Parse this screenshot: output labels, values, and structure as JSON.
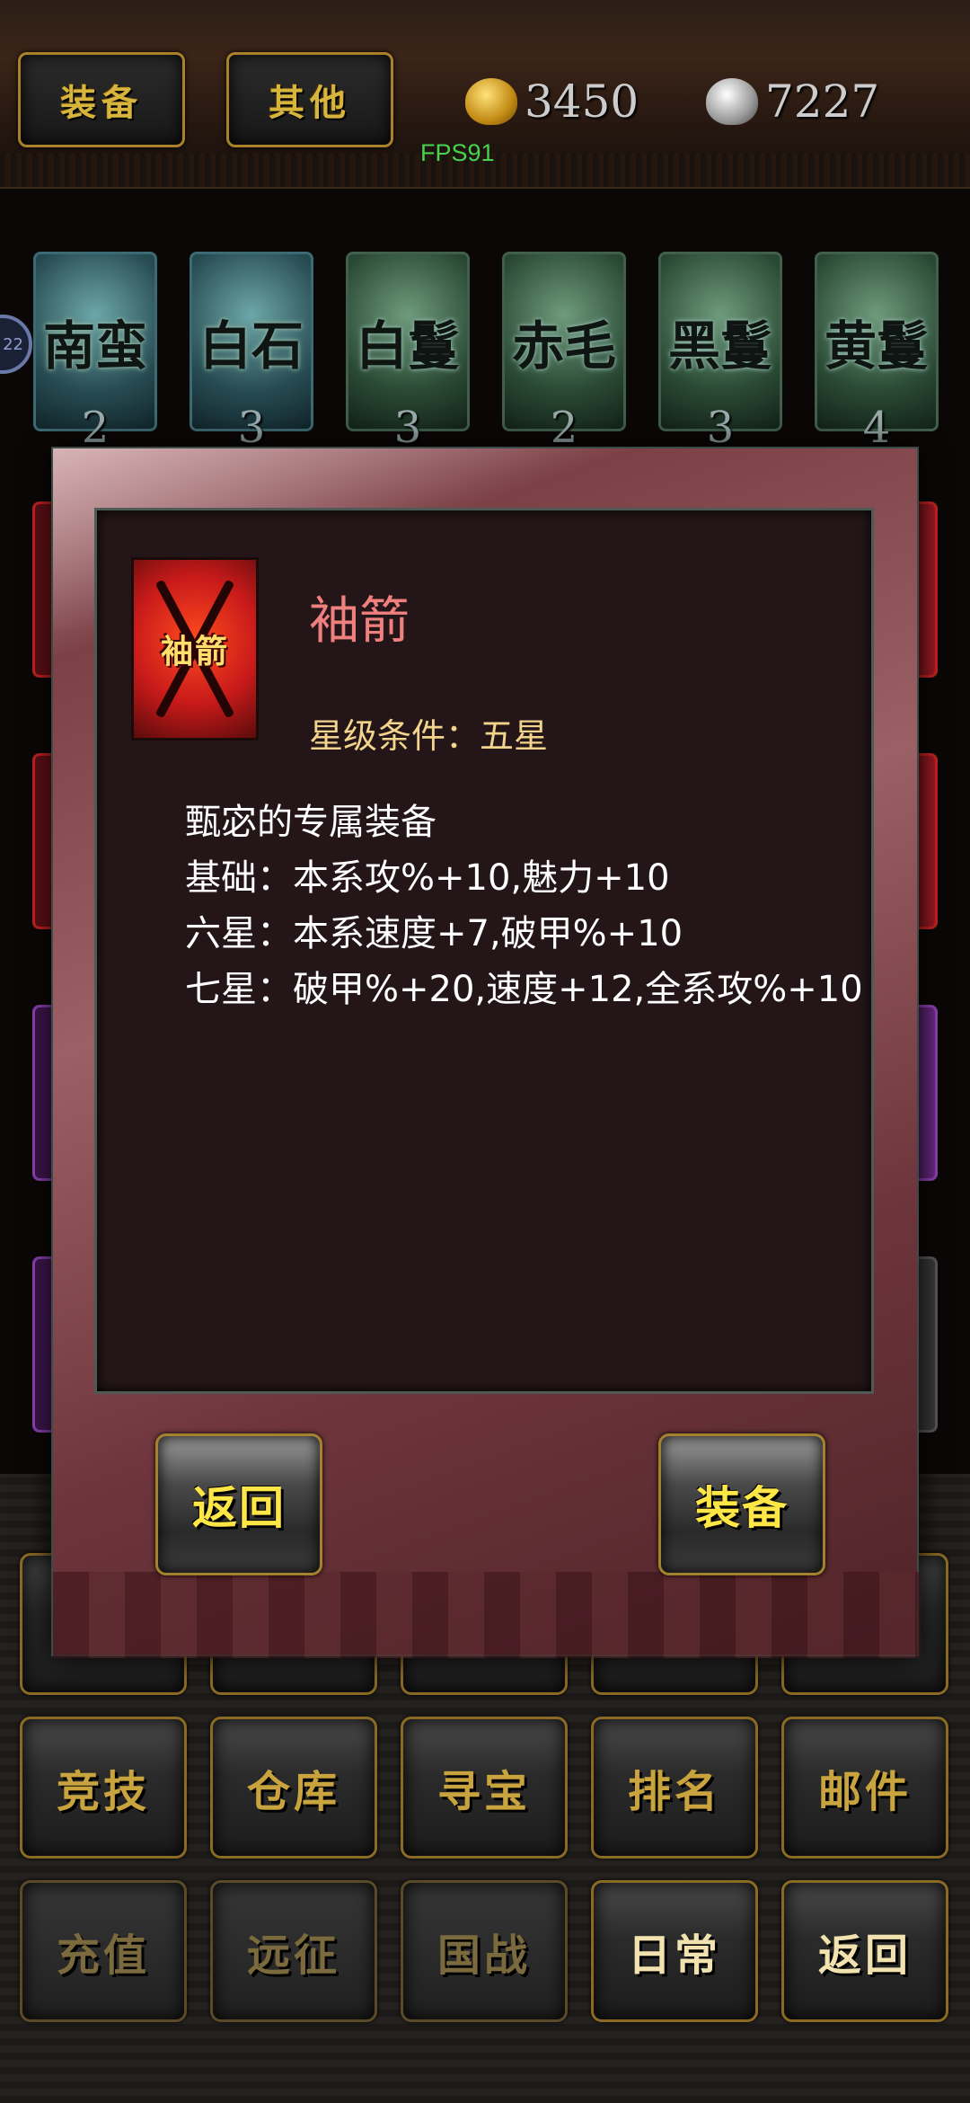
{
  "topbar": {
    "tab_equipment": "装备",
    "tab_other": "其他",
    "gold": "3450",
    "silver": "7227",
    "fps": "FPS91"
  },
  "heroes": [
    {
      "name": "南蛮",
      "count": "2",
      "tone": "blue"
    },
    {
      "name": "白石",
      "count": "3",
      "tone": "blue"
    },
    {
      "name": "白鬘",
      "count": "3",
      "tone": "green"
    },
    {
      "name": "赤毛",
      "count": "2",
      "tone": "green"
    },
    {
      "name": "黑鬘",
      "count": "3",
      "tone": "green"
    },
    {
      "name": "黄鬘",
      "count": "4",
      "tone": "green"
    }
  ],
  "side_badge": "22",
  "dialog": {
    "item_icon_text": "袖箭",
    "item_name": "袖箭",
    "star_requirement": "星级条件：五星",
    "description": [
      "甄宓的专属装备",
      "基础：本系攻%+10,魅力+10",
      "六星：本系速度+7,破甲%+10",
      "七星：破甲%+20,速度+12,全系攻%+10"
    ],
    "back_button": "返回",
    "equip_button": "装备"
  },
  "menu": {
    "row2": [
      "竞技",
      "仓库",
      "寻宝",
      "排名",
      "邮件"
    ],
    "row3": [
      "充值",
      "远征",
      "国战",
      "日常",
      "返回"
    ]
  }
}
